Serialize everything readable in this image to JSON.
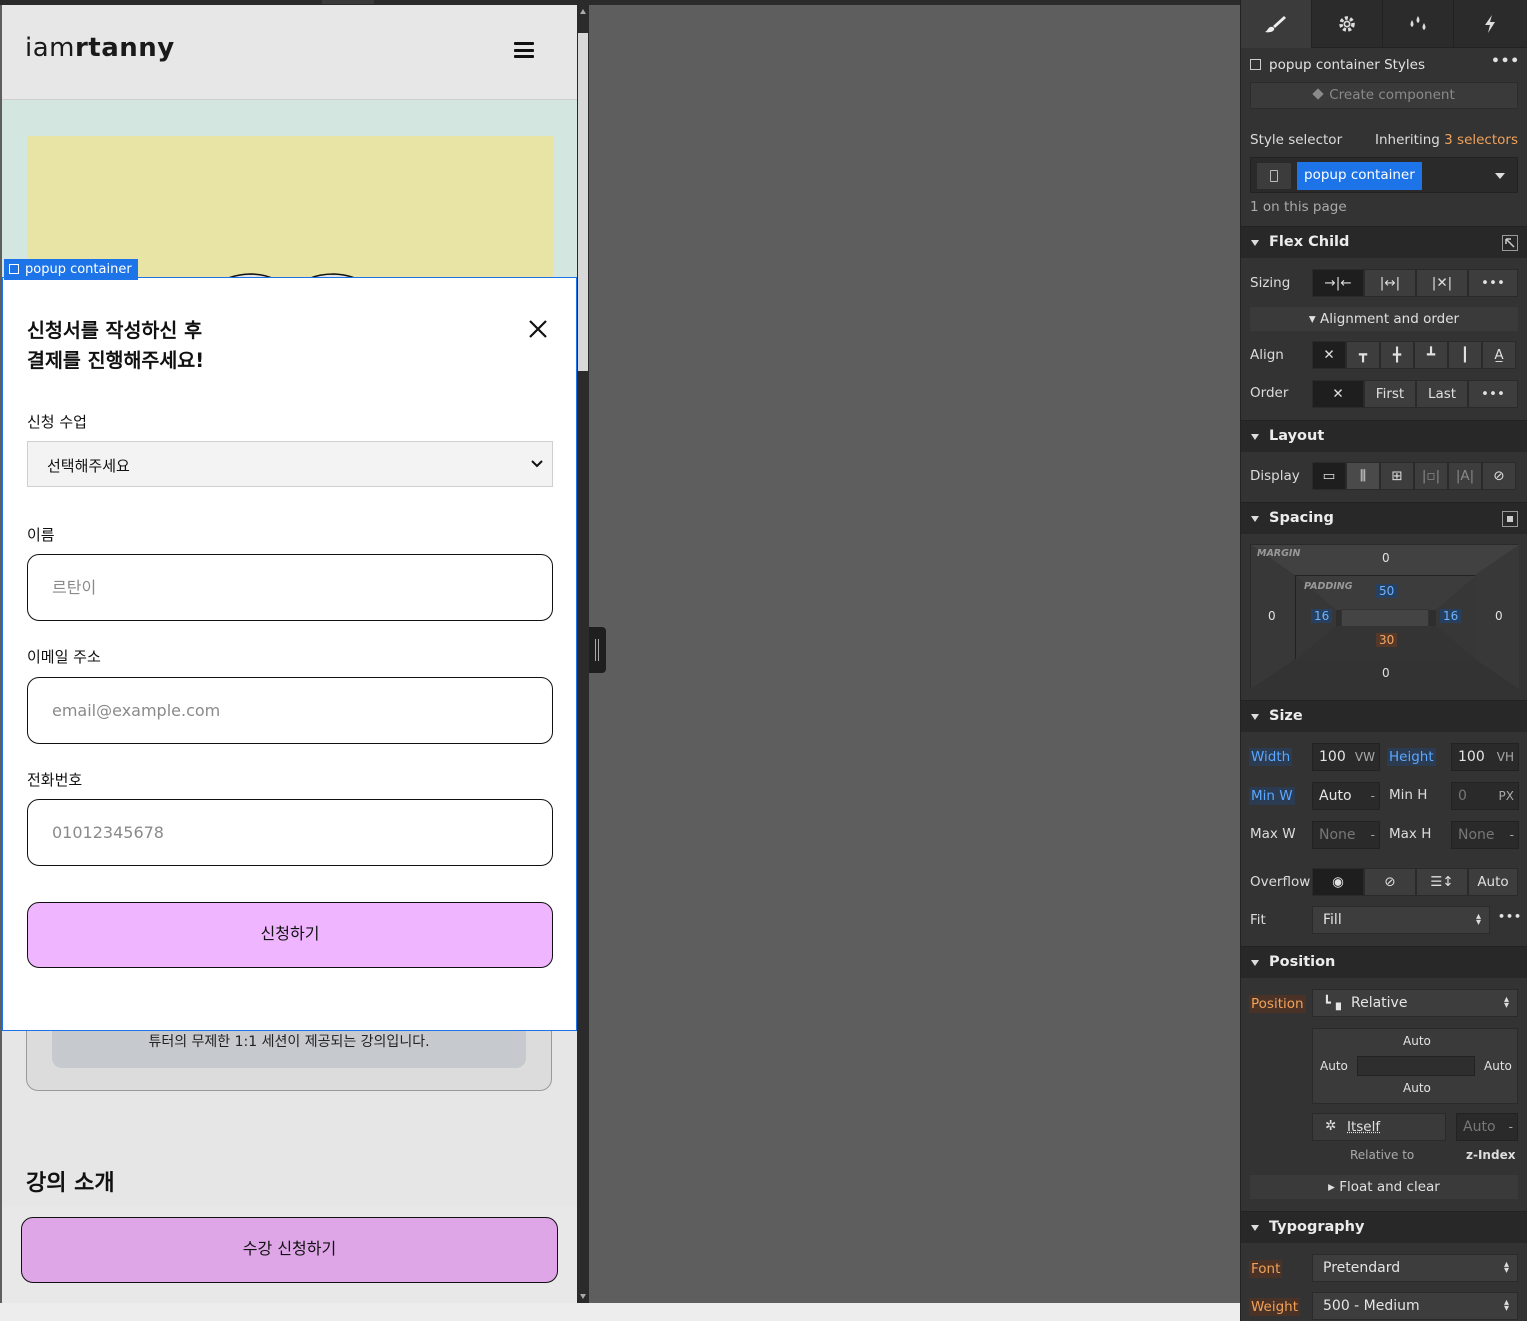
{
  "site": {
    "logo_light": "iam",
    "logo_bold": "rtanny",
    "popup_tag": "popup container",
    "popup_title": "신청서를 작성하신 후\n결제를 진행해주세요!",
    "course_label": "신청 수업",
    "course_value": "선택해주세요",
    "name_label": "이름",
    "name_placeholder": "르탄이",
    "email_label": "이메일 주소",
    "email_placeholder": "email@example.com",
    "phone_label": "전화번호",
    "phone_placeholder": "01012345678",
    "submit_label": "신청하기",
    "behind_text": "튜터의 무제한 1:1 세션이 제공되는 강의입니다.",
    "section_title": "강의 소개",
    "enroll_label": "수강 신청하기"
  },
  "panel": {
    "tabs": [
      "brush-icon",
      "gear-icon",
      "drops-icon",
      "lightning-icon"
    ],
    "styles_title": "popup container Styles",
    "create_component": "Create component",
    "style_selector_label": "Style selector",
    "inheriting_prefix": "Inheriting",
    "inheriting_link": "3 selectors",
    "selector_chip": "popup container",
    "on_page": "1 on this page",
    "flex_child": {
      "title": "Flex Child",
      "sizing_label": "Sizing",
      "alignment_order": "Alignment and order",
      "align_label": "Align",
      "order_label": "Order",
      "order_first": "First",
      "order_last": "Last"
    },
    "layout": {
      "title": "Layout",
      "display_label": "Display"
    },
    "spacing": {
      "title": "Spacing",
      "margin_label": "MARGIN",
      "padding_label": "PADDING",
      "margin": {
        "top": "0",
        "right": "0",
        "bottom": "0",
        "left": "0"
      },
      "padding": {
        "top": "50",
        "right": "16",
        "bottom": "30",
        "left": "16"
      }
    },
    "size": {
      "title": "Size",
      "width_label": "Width",
      "width_value": "100",
      "width_unit": "VW",
      "height_label": "Height",
      "height_value": "100",
      "height_unit": "VH",
      "minw_label": "Min W",
      "minw_value": "Auto",
      "minw_unit": "-",
      "minh_label": "Min H",
      "minh_value": "0",
      "minh_unit": "PX",
      "maxw_label": "Max W",
      "maxw_value": "None",
      "maxw_unit": "-",
      "maxh_label": "Max H",
      "maxh_value": "None",
      "maxh_unit": "-",
      "overflow_label": "Overflow",
      "overflow_auto": "Auto",
      "fit_label": "Fit",
      "fit_value": "Fill"
    },
    "position": {
      "title": "Position",
      "label": "Position",
      "value": "Relative",
      "top": "Auto",
      "left": "Auto",
      "right": "Auto",
      "bottom": "Auto",
      "itself": "Itself",
      "zindex_value": "Auto",
      "zindex_unit": "-",
      "relative_to": "Relative to",
      "zindex_label": "z-Index",
      "float_clear": "Float and clear"
    },
    "typography": {
      "title": "Typography",
      "font_label": "Font",
      "font_value": "Pretendard",
      "weight_label": "Weight",
      "weight_value": "500 - Medium"
    }
  },
  "colors": {
    "selection_blue": "#1d74e8",
    "submit_pink": "#efb6ff",
    "enroll_purple": "#dea5e7",
    "hero_yellow": "#e8e4a6",
    "hero_mint": "#d3e6df"
  }
}
